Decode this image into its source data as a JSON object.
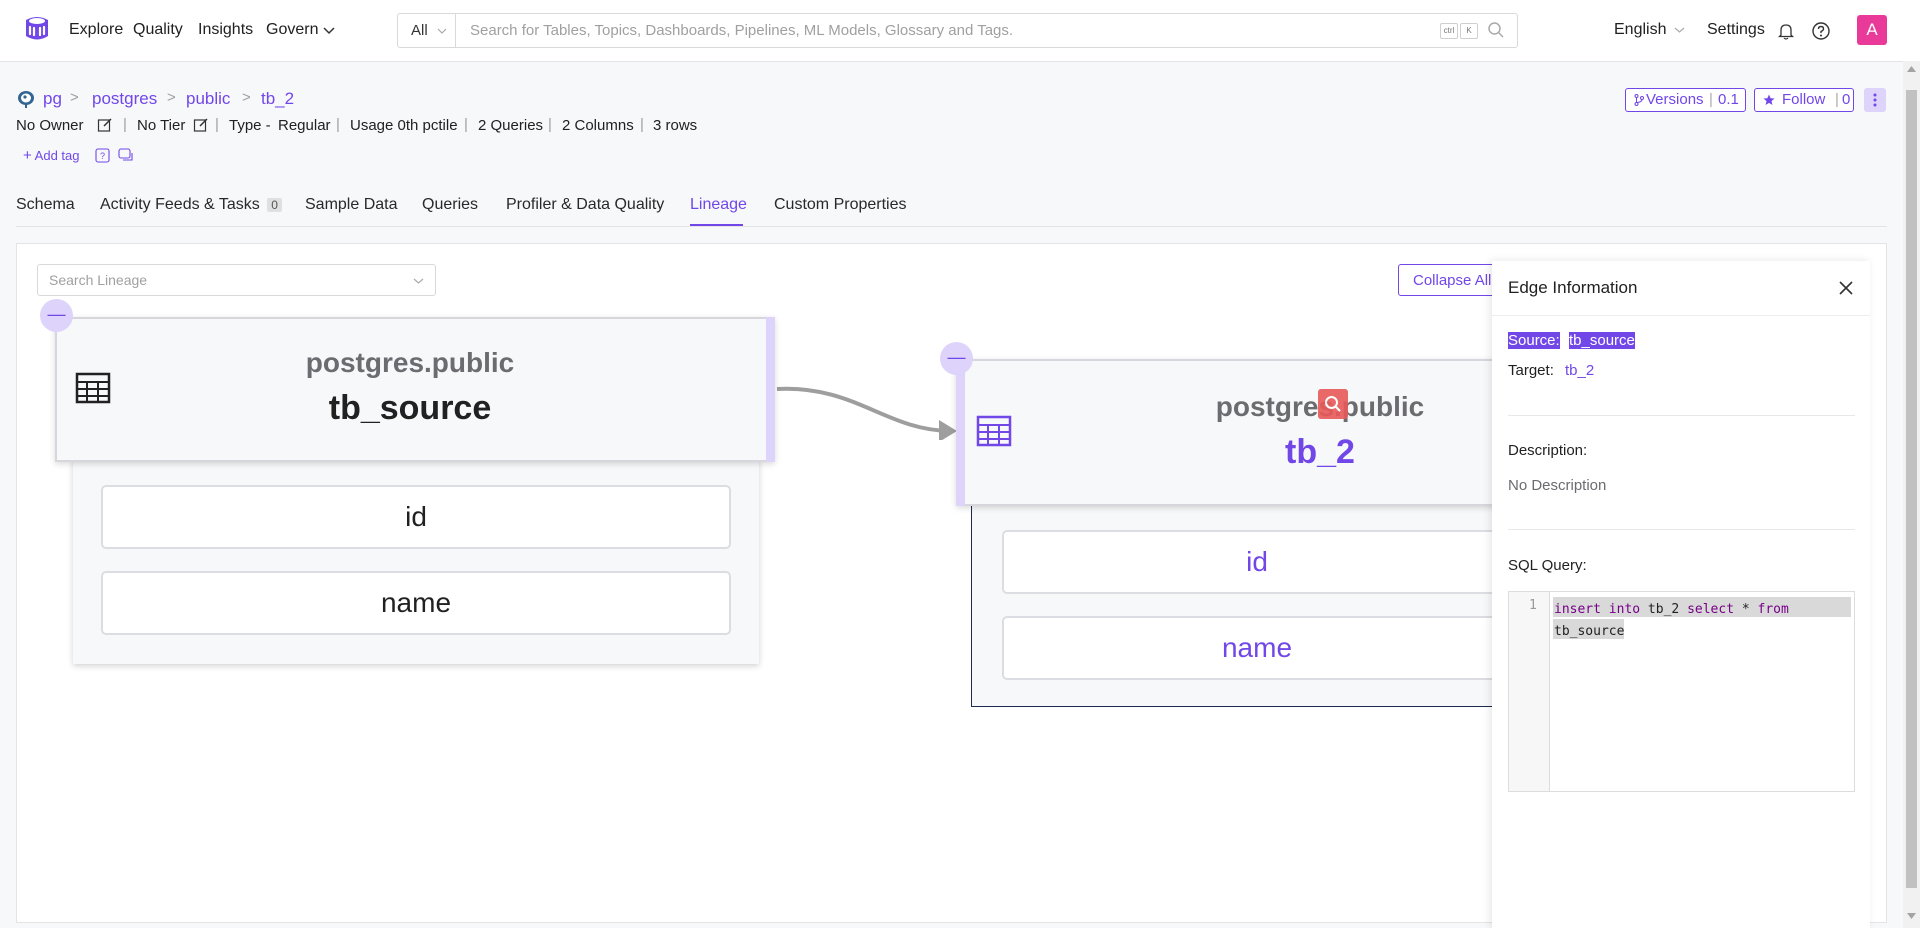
{
  "nav": {
    "items": [
      "Explore",
      "Quality",
      "Insights",
      "Govern"
    ],
    "search_category": "All",
    "search_placeholder": "Search for Tables, Topics, Dashboards, Pipelines, ML Models, Glossary and Tags.",
    "shortcut_keys": [
      "ctrl",
      "K"
    ],
    "language": "English",
    "settings": "Settings",
    "avatar_initial": "A"
  },
  "breadcrumb": [
    "pg",
    "postgres",
    "public",
    "tb_2"
  ],
  "meta": {
    "owner": "No Owner",
    "tier": "No Tier",
    "type_label": "Type -",
    "type_value": "Regular",
    "usage": "Usage 0th pctile",
    "queries": "2 Queries",
    "columns": "2 Columns",
    "rows": "3 rows",
    "add_tag": "Add tag"
  },
  "header_buttons": {
    "versions_label": "Versions",
    "versions_value": "0.1",
    "follow_label": "Follow",
    "follow_value": "0"
  },
  "tabs": [
    {
      "label": "Schema"
    },
    {
      "label": "Activity Feeds & Tasks",
      "badge": "0"
    },
    {
      "label": "Sample Data"
    },
    {
      "label": "Queries"
    },
    {
      "label": "Profiler & Data Quality"
    },
    {
      "label": "Lineage",
      "active": true
    },
    {
      "label": "Custom Properties"
    }
  ],
  "lineage": {
    "search_placeholder": "Search Lineage",
    "collapse_all": "Collapse All",
    "collapse_glyph": "—",
    "source_node": {
      "schema": "postgres.public",
      "name": "tb_source",
      "columns": [
        "id",
        "name"
      ]
    },
    "target_node": {
      "schema": "postgres.public",
      "name": "tb_2",
      "columns": [
        "id",
        "name"
      ]
    }
  },
  "edge_panel": {
    "title": "Edge Information",
    "source_label": "Source:",
    "source_value": "tb_source",
    "target_label": "Target:",
    "target_value": "tb_2",
    "description_label": "Description:",
    "description_value": "No Description",
    "sql_label": "SQL Query:",
    "sql_line_number": "1",
    "sql_keyword_1": "insert into",
    "sql_table_1": "tb_2",
    "sql_keyword_2": "select",
    "sql_star": "*",
    "sql_keyword_3": "from",
    "sql_table_2": "tb_source"
  },
  "colors": {
    "accent": "#7147e8",
    "avatar": "#e93a9a",
    "node_handle": "#ddd3fb"
  }
}
